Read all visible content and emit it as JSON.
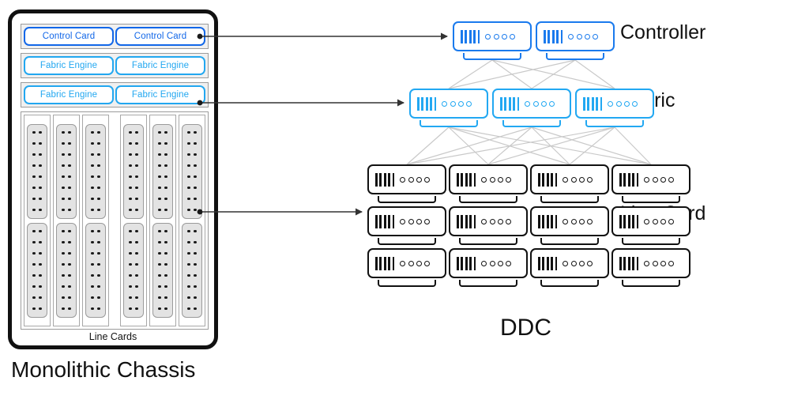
{
  "chassis": {
    "title": "Monolithic Chassis",
    "bay_label": "Line Cards",
    "rows": [
      {
        "kind": "control",
        "cards": [
          "Control Card",
          "Control Card"
        ]
      },
      {
        "kind": "fabric",
        "cards": [
          "Fabric Engine",
          "Fabric Engine"
        ]
      },
      {
        "kind": "fabric",
        "cards": [
          "Fabric Engine",
          "Fabric Engine"
        ]
      }
    ],
    "line_card_slots": 6,
    "line_card_groups": 2,
    "slots_per_group": 3,
    "cards_per_slot": 2,
    "dot_rows": 8,
    "dot_columns": 2
  },
  "ddc": {
    "title": "DDC",
    "tiers": [
      {
        "name": "controller",
        "label": "Controller",
        "count": 2
      },
      {
        "name": "fabric",
        "label": "Fabric",
        "count": 3
      },
      {
        "name": "linecard",
        "label": "Line Card",
        "count": 12,
        "rows": 3,
        "columns": 4
      }
    ],
    "device_glyph": {
      "bars": 5,
      "rings": 4
    }
  },
  "colors": {
    "control_card": "#1267e8",
    "fabric_engine": "#22a7f0",
    "controller_device": "#1a7aed",
    "fabric_device": "#22a8f2",
    "linecard_device": "#111111",
    "mesh_link": "#c9c9c9",
    "chassis_border": "#111111",
    "text": "#111111"
  },
  "annotations": {
    "arrows": [
      {
        "from": "control-card-right",
        "to": "controller-tier"
      },
      {
        "from": "fabric-engine-bottom-right",
        "to": "fabric-tier"
      },
      {
        "from": "line-card-slot-right",
        "to": "line-card-tier"
      }
    ]
  }
}
